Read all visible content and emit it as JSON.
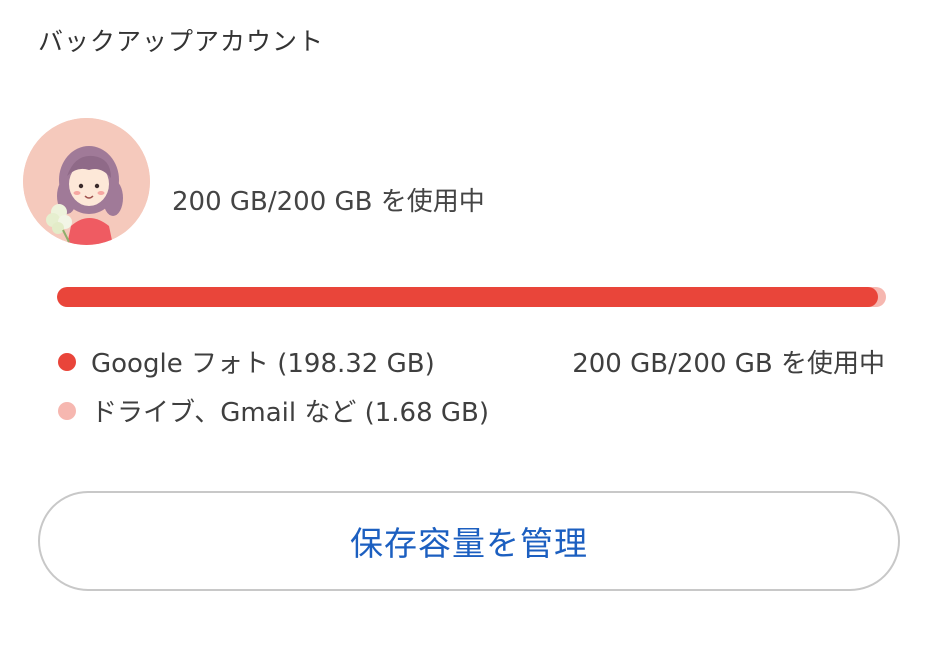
{
  "section": {
    "title": "バックアップアカウント"
  },
  "account": {
    "usage_summary": "200 GB/200 GB を使用中"
  },
  "storage": {
    "used_fraction": 0.99,
    "colors": {
      "photos": "#e9453a",
      "other": "#f6b7b0"
    },
    "legend": [
      {
        "label": "Google フォト (198.32 GB)"
      },
      {
        "label": "ドライブ、Gmail など (1.68 GB)"
      }
    ],
    "total_label": "200 GB/200 GB を使用中"
  },
  "actions": {
    "manage_label": "保存容量を管理"
  }
}
